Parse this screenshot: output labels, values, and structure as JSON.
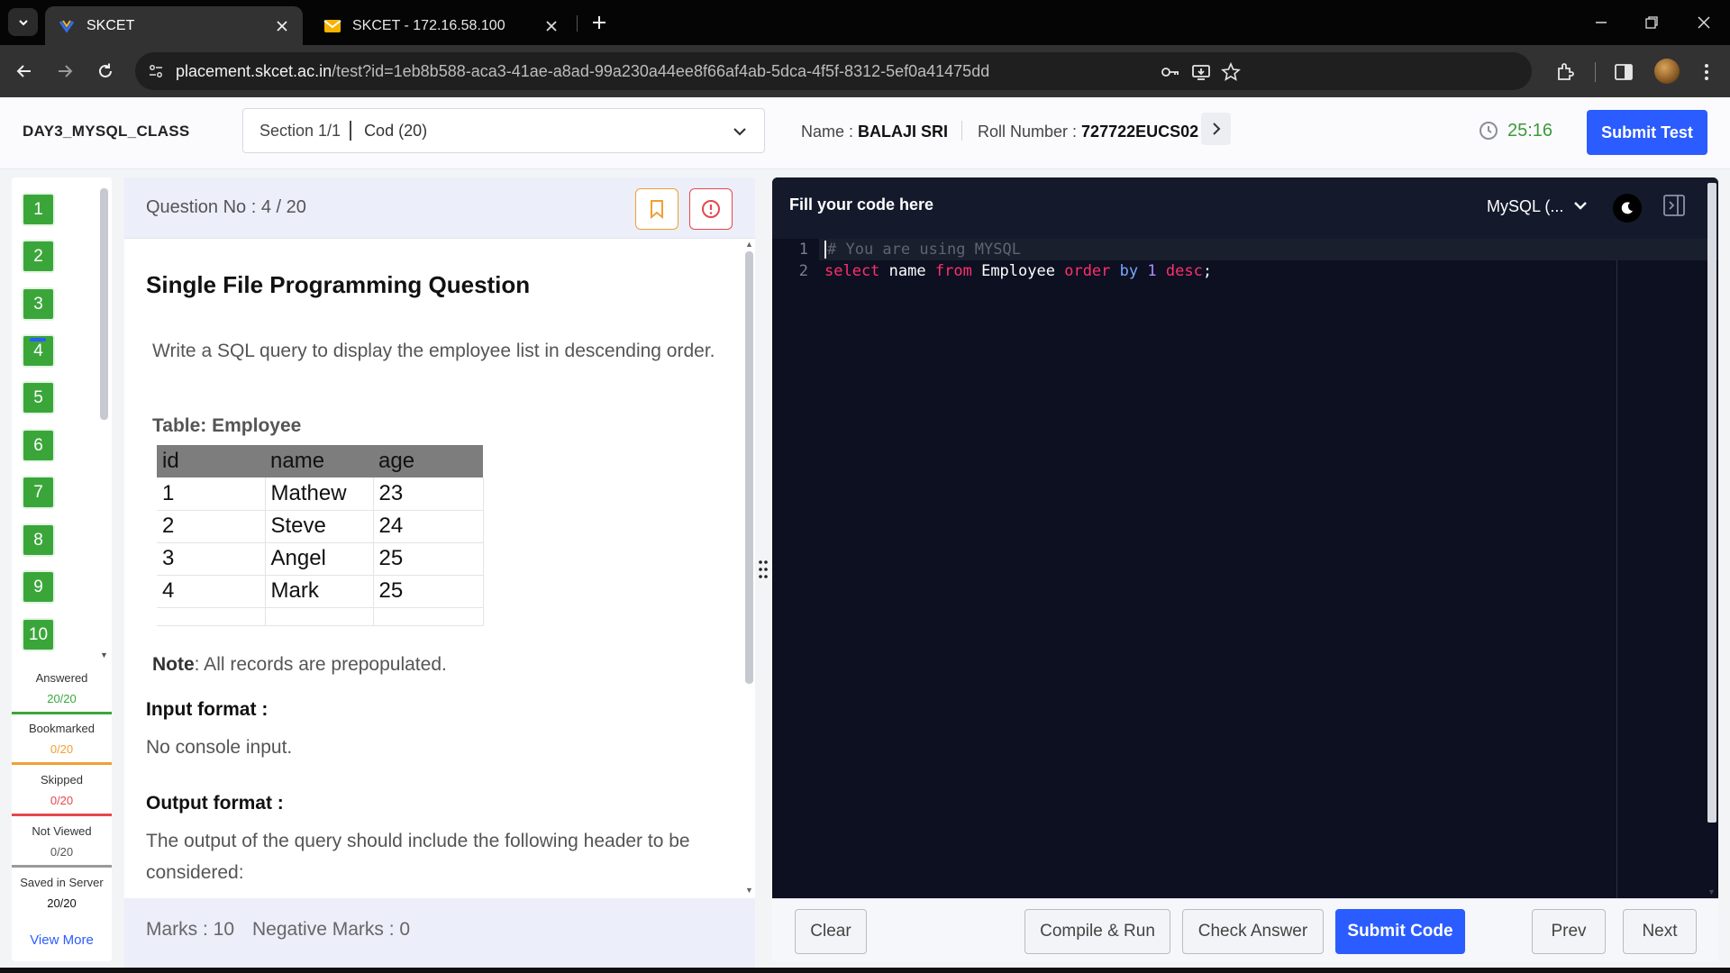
{
  "browser": {
    "tabs": [
      {
        "title": "SKCET",
        "active": true
      },
      {
        "title": "SKCET - 172.16.58.100",
        "active": false
      }
    ],
    "url_host": "placement.skcet.ac.in",
    "url_path": "/test?id=1eb8b588-aca3-41ae-a8ad-99a230a44ee8f66af4ab-5dca-4f5f-8312-5ef0a41475dd"
  },
  "header": {
    "exam_title": "DAY3_MYSQL_CLASS",
    "section_label": "Section 1/1",
    "section_value": "Cod (20)",
    "name_label": "Name :",
    "name_value": "BALAJI SRI",
    "roll_label": "Roll Number :",
    "roll_value": "727722EUCS02",
    "timer": "25:16",
    "submit_test": "Submit Test"
  },
  "qnav": {
    "questions": [
      "1",
      "2",
      "3",
      "4",
      "5",
      "6",
      "7",
      "8",
      "9",
      "10"
    ],
    "current": "4",
    "stats": [
      {
        "label": "Answered",
        "value": "20/20",
        "color": "#3aa63a"
      },
      {
        "label": "Bookmarked",
        "value": "0/20",
        "color": "#f0a033"
      },
      {
        "label": "Skipped",
        "value": "0/20",
        "color": "#e5484d"
      },
      {
        "label": "Not Viewed",
        "value": "0/20",
        "color": "#555555"
      },
      {
        "label": "Saved in Server",
        "value": "20/20",
        "color": "#111111"
      }
    ],
    "view_more": "View More"
  },
  "question": {
    "number_label": "Question No : 4 / 20",
    "type": "Single File Programming Question",
    "text": "Write a SQL query to display the employee list in descending order.",
    "table_title": "Table: Employee",
    "table_headers": [
      "id",
      "name",
      "age"
    ],
    "table_rows": [
      [
        "1",
        "Mathew",
        "23"
      ],
      [
        "2",
        "Steve",
        "24"
      ],
      [
        "3",
        "Angel",
        "25"
      ],
      [
        "4",
        "Mark",
        "25"
      ],
      [
        "",
        "",
        ""
      ]
    ],
    "note_label": "Note",
    "note_text": ": All records are prepopulated.",
    "input_format_heading": "Input format :",
    "input_format_text": "No console input.",
    "output_format_heading": "Output format :",
    "output_format_text": "The output of the query should include the following header to be considered:",
    "marks": "Marks : 10",
    "negative_marks": "Negative Marks : 0"
  },
  "editor": {
    "title": "Fill your code here",
    "language": "MySQL (...",
    "line_numbers": [
      "1",
      "2"
    ],
    "lines": [
      "# You are using MYSQL",
      "select name from Employee order by 1 desc;"
    ]
  },
  "actions": {
    "clear": "Clear",
    "compile_run": "Compile & Run",
    "check_answer": "Check Answer",
    "submit_code": "Submit Code",
    "prev": "Prev",
    "next": "Next"
  },
  "colors": {
    "primary": "#2b5cff",
    "answered_green": "#3aa63a",
    "timer_green": "#3c9a3c",
    "editor_bg": "#0c1020"
  }
}
